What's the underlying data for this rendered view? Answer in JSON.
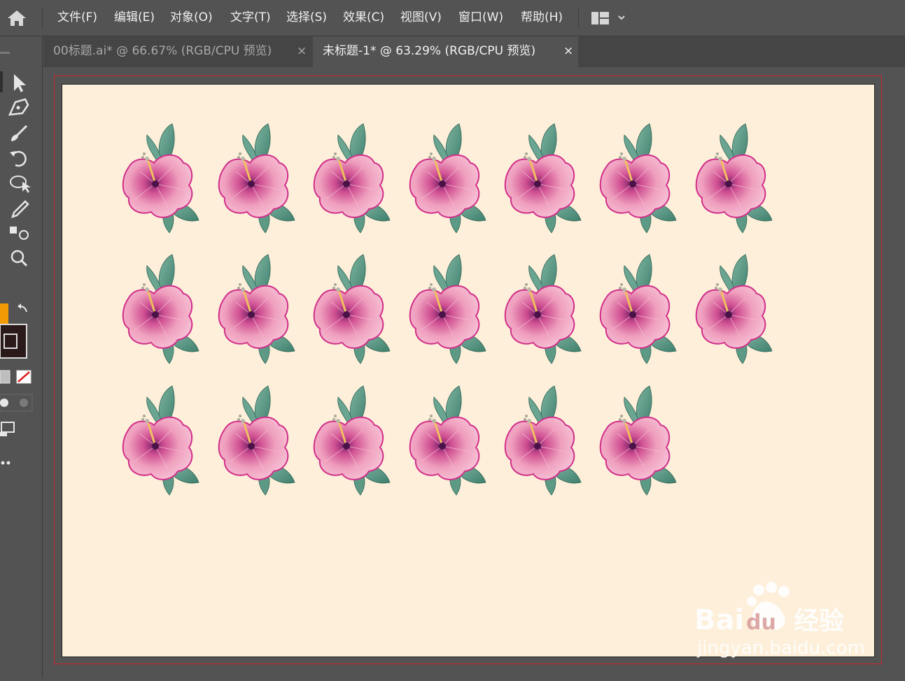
{
  "menu": {
    "items": [
      {
        "label": "文件(F)",
        "name": "menu-file"
      },
      {
        "label": "编辑(E)",
        "name": "menu-edit"
      },
      {
        "label": "对象(O)",
        "name": "menu-object"
      },
      {
        "label": "文字(T)",
        "name": "menu-type"
      },
      {
        "label": "选择(S)",
        "name": "menu-select"
      },
      {
        "label": "效果(C)",
        "name": "menu-effect"
      },
      {
        "label": "视图(V)",
        "name": "menu-view"
      },
      {
        "label": "窗口(W)",
        "name": "menu-window"
      },
      {
        "label": "帮助(H)",
        "name": "menu-help"
      }
    ],
    "home_icon": "home-icon",
    "workspace_icon": "workspace-layout-icon"
  },
  "tabs": [
    {
      "label": "00标题.ai* @ 66.67% (RGB/CPU 预览)",
      "close": "×",
      "active": false
    },
    {
      "label": "未标题-1* @ 63.29% (RGB/CPU 预览)",
      "close": "×",
      "active": true
    }
  ],
  "tools": [
    "selection-tool-icon",
    "pen-tool-icon",
    "paintbrush-tool-icon",
    "rotate-tool-icon",
    "shape-builder-tool-icon",
    "eyedropper-tool-icon",
    "blend-tool-icon",
    "zoom-tool-icon"
  ],
  "colors": {
    "fill": "#f29a06",
    "stroke": "#2a1a1a",
    "artboard": "#fdefd9",
    "bleed_line": "#c8282c",
    "petal": "#f0a2c0",
    "leaf": "#5a9a86"
  },
  "artwork": {
    "rows": [
      7,
      7,
      6
    ],
    "flower_count": 20
  },
  "watermark": {
    "logo_text": "Baidu经验",
    "url": "jingyan.baidu.com"
  }
}
